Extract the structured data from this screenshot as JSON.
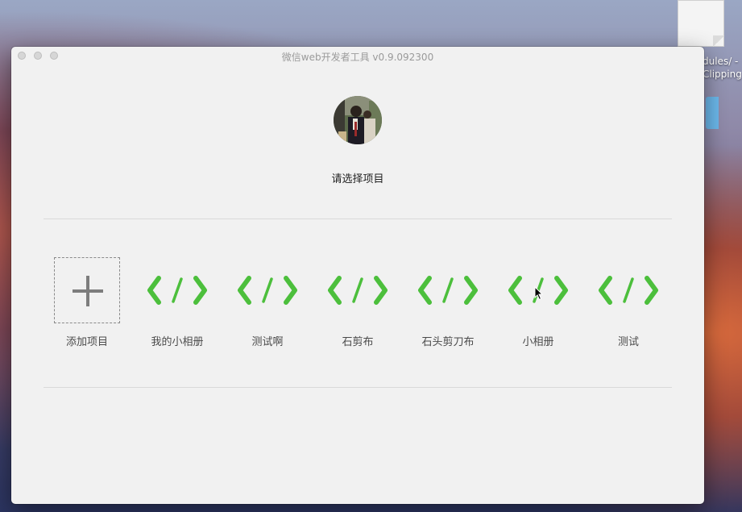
{
  "desktop": {
    "file_label_line1": "dules/ -",
    "file_label_line2": "Clipping"
  },
  "window": {
    "title": "微信web开发者工具 v0.9.092300"
  },
  "user": {
    "avatar_icon": "user-avatar-photo"
  },
  "prompt": "请选择项目",
  "add_project": {
    "label": "添加项目",
    "icon": "plus-icon"
  },
  "projects": [
    {
      "label": "我的小相册",
      "icon": "code-icon"
    },
    {
      "label": "测试啊",
      "icon": "code-icon"
    },
    {
      "label": "石剪布",
      "icon": "code-icon"
    },
    {
      "label": "石头剪刀布",
      "icon": "code-icon"
    },
    {
      "label": "小相册",
      "icon": "code-icon"
    },
    {
      "label": "测试",
      "icon": "code-icon"
    }
  ],
  "colors": {
    "code_icon": "#4cbf3c",
    "window_bg": "#f1f1f1"
  }
}
